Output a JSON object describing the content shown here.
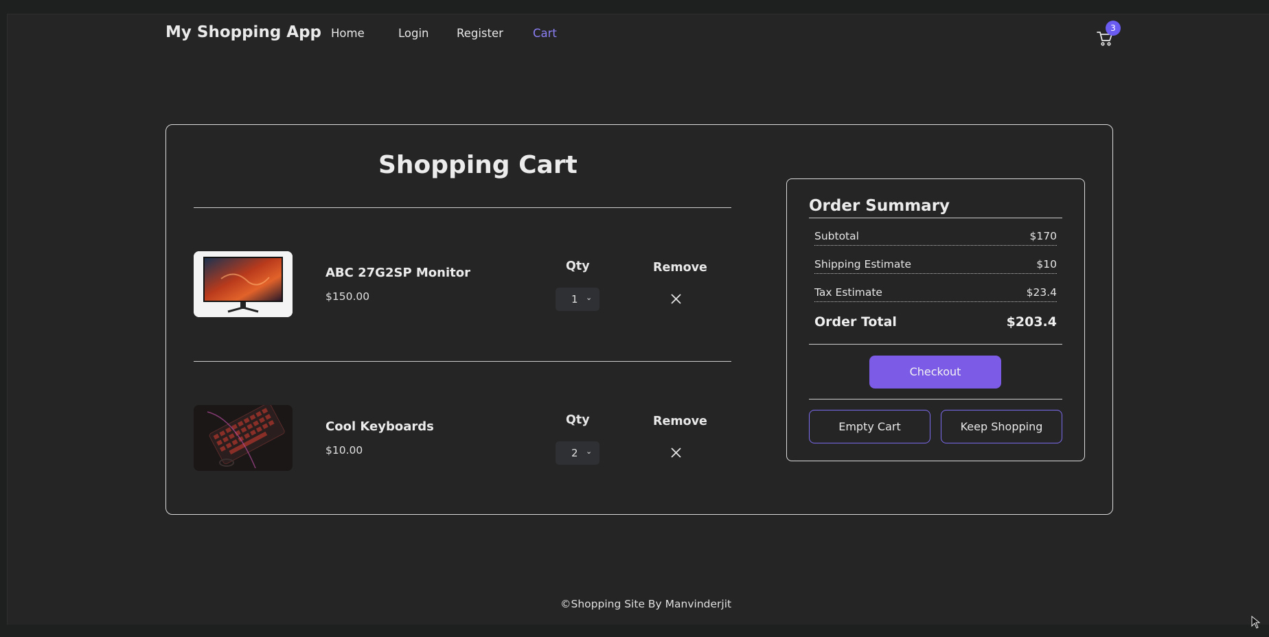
{
  "nav": {
    "brand": "My Shopping App",
    "links": [
      {
        "label": "Home",
        "active": false
      },
      {
        "label": "Login",
        "active": false
      },
      {
        "label": "Register",
        "active": false
      },
      {
        "label": "Cart",
        "active": true
      }
    ],
    "cart_count": "3",
    "cart_icon": "shopping-cart-icon"
  },
  "cart": {
    "title": "Shopping Cart",
    "qty_header": "Qty",
    "remove_header": "Remove",
    "items": [
      {
        "name": "ABC 27G2SP Monitor",
        "price": "$150.00",
        "qty": "1",
        "image": "monitor-image"
      },
      {
        "name": "Cool Keyboards",
        "price": "$10.00",
        "qty": "2",
        "image": "keyboard-image"
      }
    ]
  },
  "summary": {
    "title": "Order Summary",
    "rows": [
      {
        "label": "Subtotal",
        "amount": "$170"
      },
      {
        "label": "Shipping Estimate",
        "amount": "$10"
      },
      {
        "label": "Tax Estimate",
        "amount": "$23.4"
      }
    ],
    "total_label": "Order Total",
    "total_amount": "$203.4",
    "checkout_label": "Checkout",
    "empty_label": "Empty Cart",
    "keep_label": "Keep Shopping"
  },
  "footer": {
    "text": "©Shopping Site By Manvinderjit"
  },
  "colors": {
    "accent": "#7c5ce6",
    "active_link": "#8b7ff5",
    "badge": "#6a5cf0",
    "background": "#252525"
  }
}
